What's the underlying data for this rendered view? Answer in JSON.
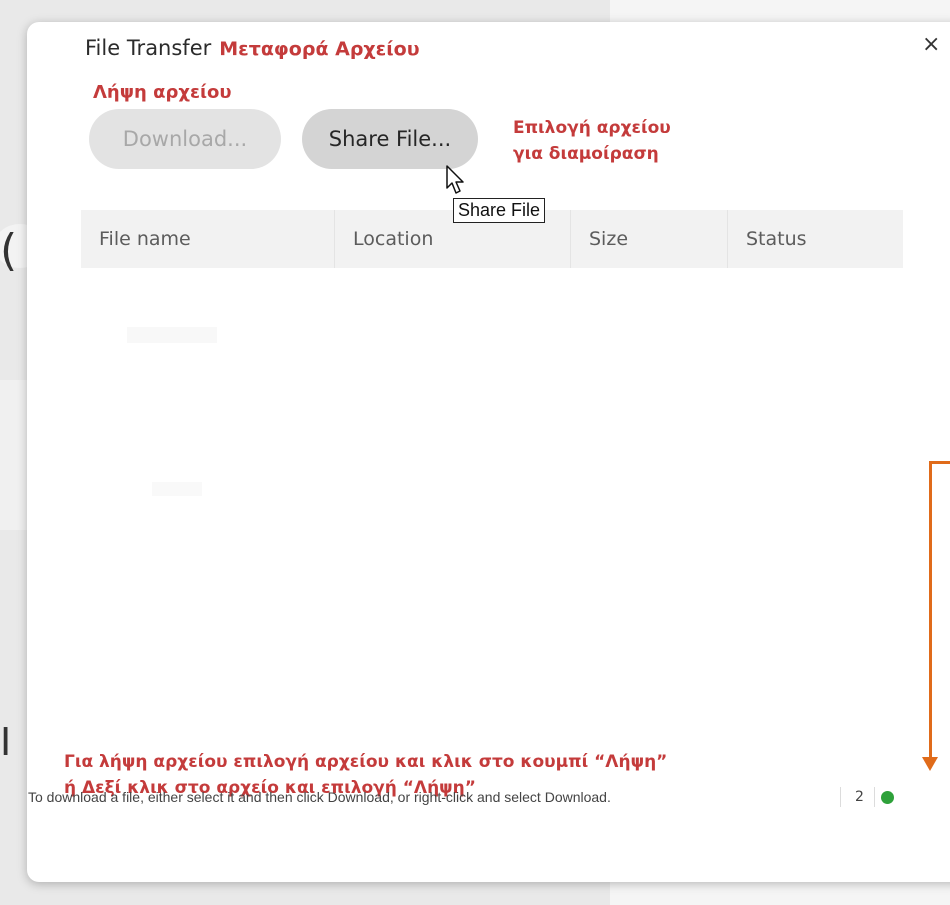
{
  "dialog": {
    "title": "File Transfer",
    "title_annotation": "Μεταφορά Αρχείου",
    "close_label": "×",
    "download_annotation": "Λήψη αρχείου",
    "download_button": "Download...",
    "share_button": "Share File...",
    "share_annotation_line1": "Επιλογή αρχείου",
    "share_annotation_line2": "για διαμοίραση",
    "tooltip": "Share File",
    "columns": [
      "File name",
      "Location",
      "Size",
      "Status"
    ],
    "bottom_annotation_line1": "Για λήψη αρχείου επιλογή αρχείου και κλικ στο κουμπί “Λήψη”",
    "bottom_annotation_line2": "ή Δεξί κλικ στο αρχείο και επιλογή “Λήψη”",
    "status_message": "To download a file, either select it and then click Download, or right-click and select Download.",
    "status_count": "2",
    "status_indicator_color": "#2ea13a",
    "annotation_color": "#c43b3b",
    "arrow_color": "#e06b1a"
  },
  "background": {
    "edge_glyph_top": "(",
    "edge_glyph_bottom": "I"
  },
  "icons": {
    "close": "close-icon",
    "cursor": "mouse-pointer-icon",
    "status": "status-dot-icon"
  }
}
